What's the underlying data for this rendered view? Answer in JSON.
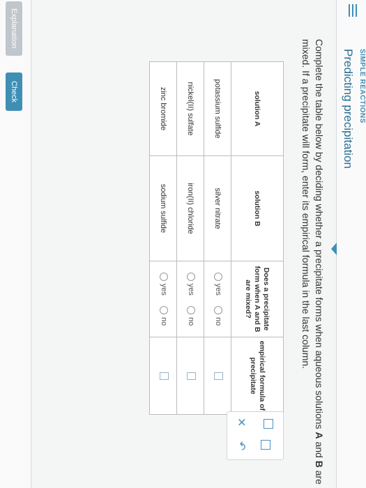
{
  "header": {
    "topic": "SIMPLE REACTIONS",
    "title": "Predicting precipitation"
  },
  "question": {
    "part1": "Complete the table below by deciding whether a precipitate forms when aqueous solutions ",
    "bold1": "A",
    "part2": " and ",
    "bold2": "B",
    "part3": " are mixed. If a precipitate will form, enter its empirical formula in the last column."
  },
  "table": {
    "headers": [
      "solution A",
      "solution B",
      "Does a precipitate form when A and B are mixed?",
      "empirical formula of precipitate"
    ],
    "rows": [
      {
        "a": "potassium sulfide",
        "b": "silver nitrate"
      },
      {
        "a": "nickel(II) sulfate",
        "b": "iron(II) chloride"
      },
      {
        "a": "zinc bromide",
        "b": "sodium sulfide"
      }
    ],
    "option_yes": "yes",
    "option_no": "no"
  },
  "tools": {
    "clear_icon": "x-icon",
    "undo_icon": "undo-icon",
    "subscript_icon": "subscript-icon",
    "superscript_icon": "superscript-icon"
  },
  "footer": {
    "explanation_label": "Explanation",
    "check_label": "Check"
  },
  "colors": {
    "accent": "#3f8fb5",
    "title": "#2a6f93"
  }
}
